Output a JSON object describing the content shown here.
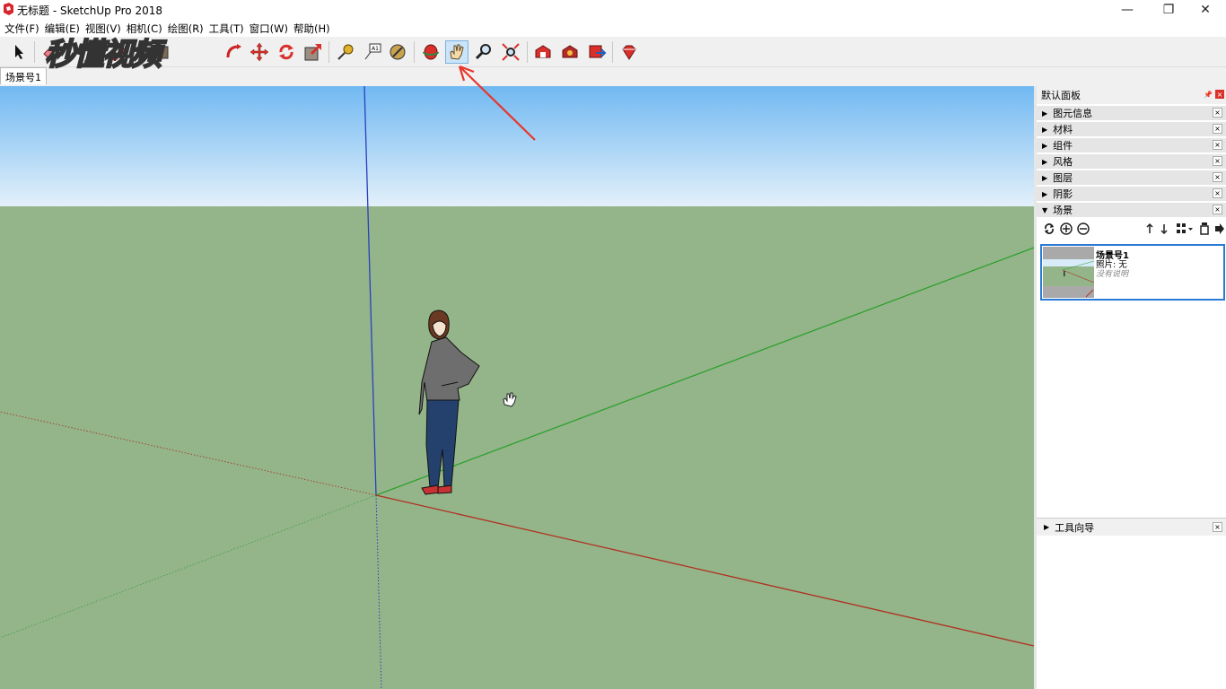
{
  "window": {
    "title": "无标题 - SketchUp Pro 2018",
    "minimize": "—",
    "restore": "❐",
    "close": "✕"
  },
  "menu": [
    "文件(F)",
    "编辑(E)",
    "视图(V)",
    "相机(C)",
    "绘图(R)",
    "工具(T)",
    "窗口(W)",
    "帮助(H)"
  ],
  "watermark": "秒懂视频",
  "scene_tab": "场景号1",
  "toolbar": {
    "active_tool": "pan-tool",
    "tools": [
      "select",
      "eraser",
      "pencil",
      "paint-bucket",
      "push-pull",
      "rotate",
      "move",
      "follow-me",
      "scale",
      "tape-measure",
      "text",
      "paint",
      "orbit",
      "pan",
      "zoom",
      "zoom-extents",
      "warehouse",
      "extension-warehouse",
      "share",
      "ruby"
    ]
  },
  "tray": {
    "header": "默认面板",
    "pin_icon": "📌",
    "close_icon": "×",
    "panels": [
      {
        "label": "图元信息",
        "expanded": false
      },
      {
        "label": "材料",
        "expanded": false
      },
      {
        "label": "组件",
        "expanded": false
      },
      {
        "label": "风格",
        "expanded": false
      },
      {
        "label": "图层",
        "expanded": false
      },
      {
        "label": "阴影",
        "expanded": false
      },
      {
        "label": "场景",
        "expanded": true
      }
    ],
    "collapsed_arrow": "▶",
    "expanded_arrow": "▼",
    "close_x": "×",
    "scene_card": {
      "name": "场景号1",
      "photo": "照片: 无",
      "description": "没有说明"
    },
    "tool_guide": "工具向导"
  },
  "colors": {
    "sky_top": "#71b9f2",
    "sky_bottom": "#e3f0fa",
    "ground": "#94b58a",
    "axis_blue": "#2a3fbf",
    "axis_green": "#2ea02e",
    "axis_red": "#b03020",
    "annotation_arrow": "#e8362a",
    "selection_blue": "#2a7ad5"
  }
}
